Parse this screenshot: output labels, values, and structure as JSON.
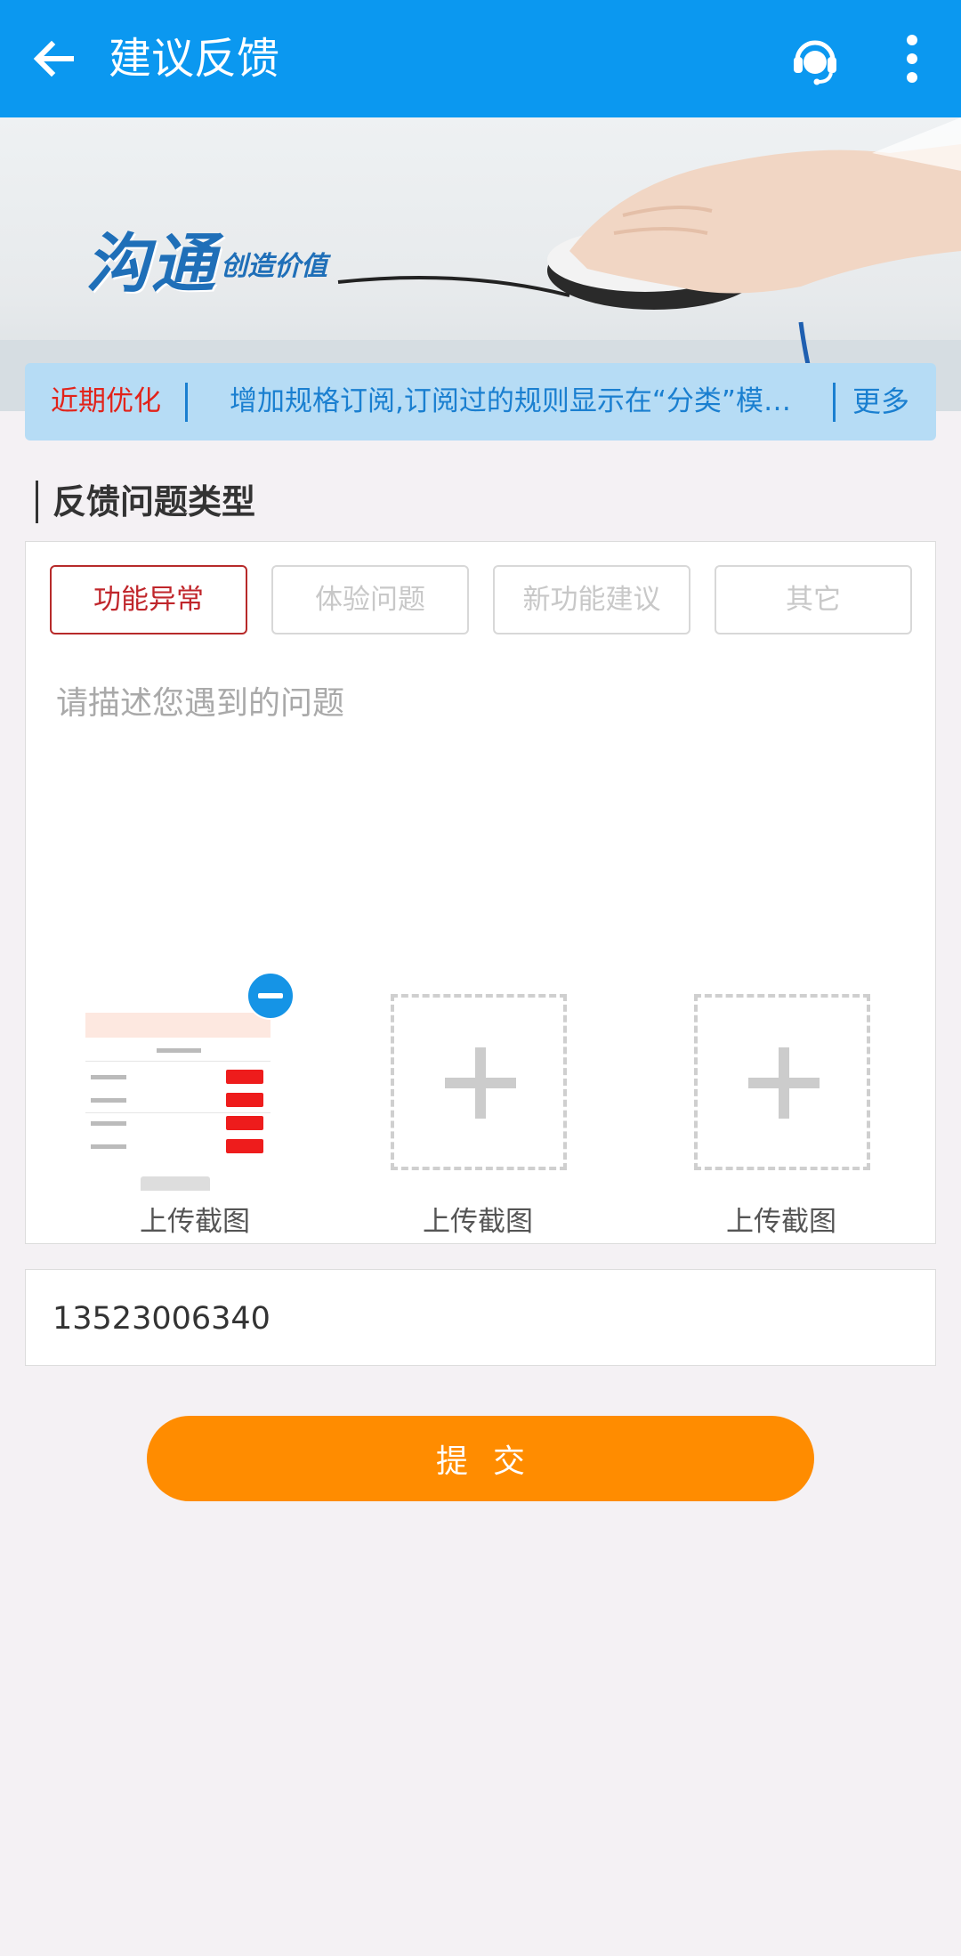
{
  "appbar": {
    "title": "建议反馈",
    "back_icon": "arrow-left-icon",
    "support_icon": "headset-icon",
    "more_icon": "more-vertical-icon",
    "color": "#0b98f0"
  },
  "banner": {
    "title": "沟通",
    "subtitle": "创造价值"
  },
  "notice": {
    "tag": "近期优化",
    "text": "增加规格订阅,订阅过的规则显示在“分类”模…",
    "more": "更多"
  },
  "section": {
    "title": "反馈问题类型"
  },
  "types": [
    {
      "label": "功能异常",
      "selected": true
    },
    {
      "label": "体验问题",
      "selected": false
    },
    {
      "label": "新功能建议",
      "selected": false
    },
    {
      "label": "其它",
      "selected": false
    }
  ],
  "description": {
    "placeholder": "请描述您遇到的问题",
    "value": ""
  },
  "uploads": [
    {
      "label": "上传截图",
      "has_image": true
    },
    {
      "label": "上传截图",
      "has_image": false
    },
    {
      "label": "上传截图",
      "has_image": false
    }
  ],
  "contact": {
    "value": "13523006340"
  },
  "submit": {
    "label": "提交",
    "color": "#ff8c00"
  }
}
